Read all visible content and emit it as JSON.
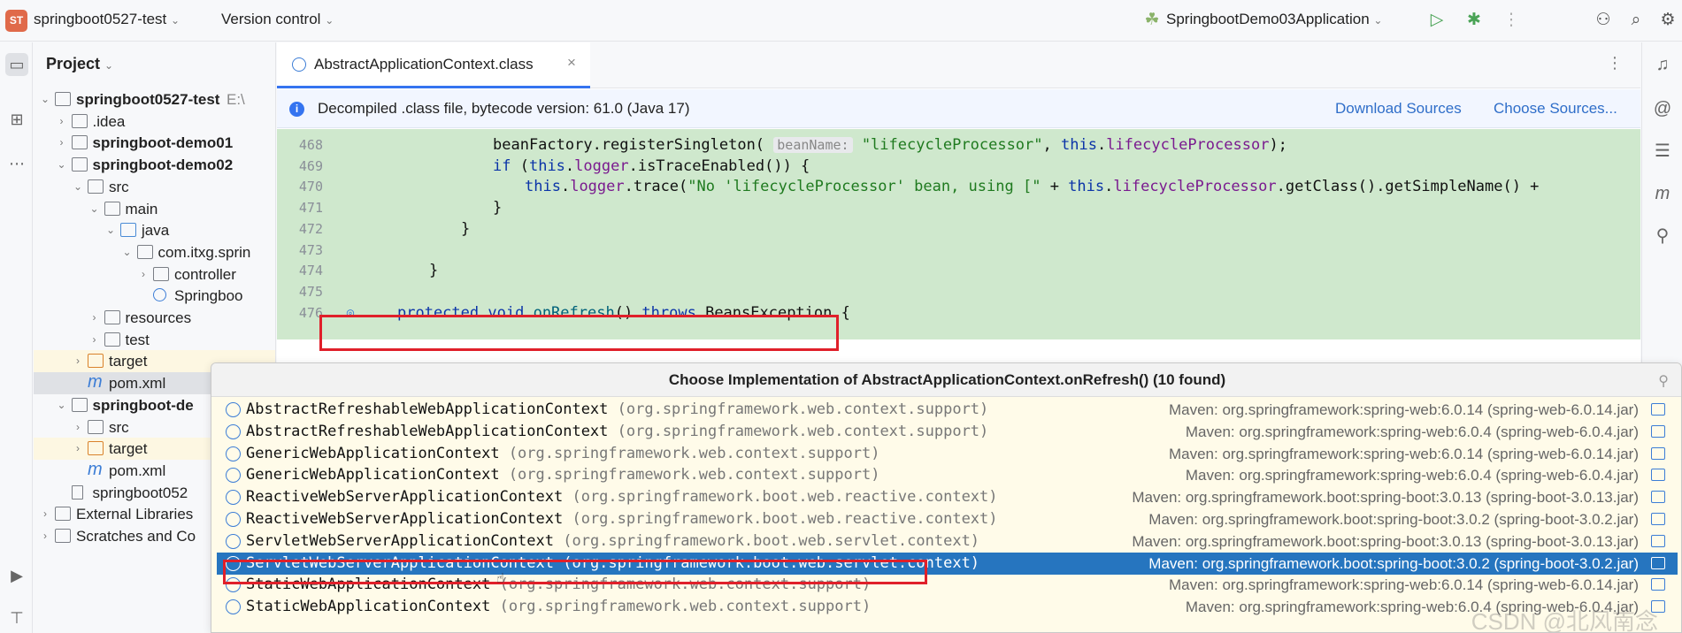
{
  "topbar": {
    "project_badge": "ST",
    "project_name": "springboot0527-test",
    "vcs": "Version control",
    "run_config": "SpringbootDemo03Application"
  },
  "project_panel": {
    "title": "Project",
    "tree": [
      {
        "label": "springboot0527-test",
        "suffix": "E:\\",
        "indent": 0,
        "chevron": "v",
        "icon": "module",
        "bold": true
      },
      {
        "label": ".idea",
        "indent": 1,
        "chevron": ">",
        "icon": "folder"
      },
      {
        "label": "springboot-demo01",
        "indent": 1,
        "chevron": ">",
        "icon": "module",
        "bold": true
      },
      {
        "label": "springboot-demo02",
        "indent": 1,
        "chevron": "v",
        "icon": "module",
        "bold": true
      },
      {
        "label": "src",
        "indent": 2,
        "chevron": "v",
        "icon": "folder"
      },
      {
        "label": "main",
        "indent": 3,
        "chevron": "v",
        "icon": "folder"
      },
      {
        "label": "java",
        "indent": 4,
        "chevron": "v",
        "icon": "folder-b"
      },
      {
        "label": "com.itxg.sprin",
        "indent": 5,
        "chevron": "v",
        "icon": "package"
      },
      {
        "label": "controller",
        "indent": 6,
        "chevron": ">",
        "icon": "package"
      },
      {
        "label": "Springboo",
        "indent": 6,
        "chevron": "",
        "icon": "cls"
      },
      {
        "label": "resources",
        "indent": 3,
        "chevron": ">",
        "icon": "folder"
      },
      {
        "label": "test",
        "indent": 3,
        "chevron": ">",
        "icon": "folder"
      },
      {
        "label": "target",
        "indent": 2,
        "chevron": ">",
        "icon": "folder-o",
        "highlight": true
      },
      {
        "label": "pom.xml",
        "indent": 2,
        "chevron": "",
        "icon": "m",
        "selected": true
      },
      {
        "label": "springboot-de",
        "indent": 1,
        "chevron": "v",
        "icon": "module",
        "bold": true
      },
      {
        "label": "src",
        "indent": 2,
        "chevron": ">",
        "icon": "folder"
      },
      {
        "label": "target",
        "indent": 2,
        "chevron": ">",
        "icon": "folder-o",
        "highlight": true
      },
      {
        "label": "pom.xml",
        "indent": 2,
        "chevron": "",
        "icon": "m"
      },
      {
        "label": "springboot052",
        "indent": 1,
        "chevron": "",
        "icon": "file"
      },
      {
        "label": "External Libraries",
        "indent": 0,
        "chevron": ">",
        "icon": "lib"
      },
      {
        "label": "Scratches and Co",
        "indent": 0,
        "chevron": ">",
        "icon": "scratch"
      }
    ]
  },
  "editor": {
    "tab_label": "AbstractApplicationContext.class",
    "info_text": "Decompiled .class file, bytecode version: 61.0 (Java 17)",
    "download_sources": "Download Sources",
    "choose_sources": "Choose Sources...",
    "lines": [
      {
        "num": "468",
        "indent": 4,
        "parts": [
          [
            "t",
            "beanFactory.registerSingleton( "
          ],
          [
            "hint",
            "beanName:"
          ],
          [
            "t",
            " "
          ],
          [
            "str",
            "\"lifecycleProcessor\""
          ],
          [
            "t",
            ", "
          ],
          [
            "kw",
            "this"
          ],
          [
            "t",
            "."
          ],
          [
            "fld",
            "lifecycleProcessor"
          ],
          [
            "t",
            ");"
          ]
        ]
      },
      {
        "num": "469",
        "indent": 4,
        "parts": [
          [
            "kw",
            "if"
          ],
          [
            "t",
            " ("
          ],
          [
            "kw",
            "this"
          ],
          [
            "t",
            "."
          ],
          [
            "fld",
            "logger"
          ],
          [
            "t",
            ".isTraceEnabled()) {"
          ]
        ]
      },
      {
        "num": "470",
        "indent": 5,
        "parts": [
          [
            "kw",
            "this"
          ],
          [
            "t",
            "."
          ],
          [
            "fld",
            "logger"
          ],
          [
            "t",
            ".trace("
          ],
          [
            "str",
            "\"No 'lifecycleProcessor' bean, using [\""
          ],
          [
            "t",
            " + "
          ],
          [
            "kw",
            "this"
          ],
          [
            "t",
            "."
          ],
          [
            "fld",
            "lifecycleProcessor"
          ],
          [
            "t",
            ".getClass().getSimpleName() +"
          ]
        ]
      },
      {
        "num": "471",
        "indent": 4,
        "parts": [
          [
            "t",
            "}"
          ]
        ]
      },
      {
        "num": "472",
        "indent": 3,
        "parts": [
          [
            "t",
            "}"
          ]
        ]
      },
      {
        "num": "473",
        "indent": 0,
        "parts": []
      },
      {
        "num": "474",
        "indent": 2,
        "parts": [
          [
            "t",
            "}"
          ]
        ]
      },
      {
        "num": "475",
        "indent": 0,
        "parts": []
      },
      {
        "num": "476",
        "indent": 1,
        "parts": [
          [
            "kw",
            "protected"
          ],
          [
            "t",
            " "
          ],
          [
            "kw",
            "void"
          ],
          [
            "t",
            " "
          ],
          [
            "method",
            "onRefresh"
          ],
          [
            "t",
            "() "
          ],
          [
            "kw",
            "throws"
          ],
          [
            "t",
            " BeansException {"
          ]
        ]
      }
    ]
  },
  "popup": {
    "title": "Choose Implementation of AbstractApplicationContext.onRefresh() (10 found)",
    "items": [
      {
        "cls": "AbstractRefreshableWebApplicationContext",
        "pkg": "(org.springframework.web.context.support)",
        "maven": "Maven: org.springframework:spring-web:6.0.14 (spring-web-6.0.14.jar)"
      },
      {
        "cls": "AbstractRefreshableWebApplicationContext",
        "pkg": "(org.springframework.web.context.support)",
        "maven": "Maven: org.springframework:spring-web:6.0.4 (spring-web-6.0.4.jar)"
      },
      {
        "cls": "GenericWebApplicationContext",
        "pkg": "(org.springframework.web.context.support)",
        "maven": "Maven: org.springframework:spring-web:6.0.14 (spring-web-6.0.14.jar)"
      },
      {
        "cls": "GenericWebApplicationContext",
        "pkg": "(org.springframework.web.context.support)",
        "maven": "Maven: org.springframework:spring-web:6.0.4 (spring-web-6.0.4.jar)"
      },
      {
        "cls": "ReactiveWebServerApplicationContext",
        "pkg": "(org.springframework.boot.web.reactive.context)",
        "maven": "Maven: org.springframework.boot:spring-boot:3.0.13 (spring-boot-3.0.13.jar)"
      },
      {
        "cls": "ReactiveWebServerApplicationContext",
        "pkg": "(org.springframework.boot.web.reactive.context)",
        "maven": "Maven: org.springframework.boot:spring-boot:3.0.2 (spring-boot-3.0.2.jar)"
      },
      {
        "cls": "ServletWebServerApplicationContext",
        "pkg": "(org.springframework.boot.web.servlet.context)",
        "maven": "Maven: org.springframework.boot:spring-boot:3.0.13 (spring-boot-3.0.13.jar)"
      },
      {
        "cls": "ServletWebServerApplicationContext",
        "pkg": "(org.springframework.boot.web.servlet.context)",
        "maven": "Maven: org.springframework.boot:spring-boot:3.0.2 (spring-boot-3.0.2.jar)",
        "selected": true
      },
      {
        "cls": "StaticWebApplicationContext",
        "pkg": "(org.springframework.web.context.support)",
        "maven": "Maven: org.springframework:spring-web:6.0.14 (spring-web-6.0.14.jar)"
      },
      {
        "cls": "StaticWebApplicationContext",
        "pkg": "(org.springframework.web.context.support)",
        "maven": "Maven: org.springframework:spring-web:6.0.4 (spring-web-6.0.4.jar)"
      }
    ]
  },
  "watermark": "CSDN @北风南念",
  "colors": {
    "accent": "#3574f0",
    "selection": "#2675bf",
    "highlight_box": "#e0202a",
    "code_bg": "#cfe8cd"
  }
}
